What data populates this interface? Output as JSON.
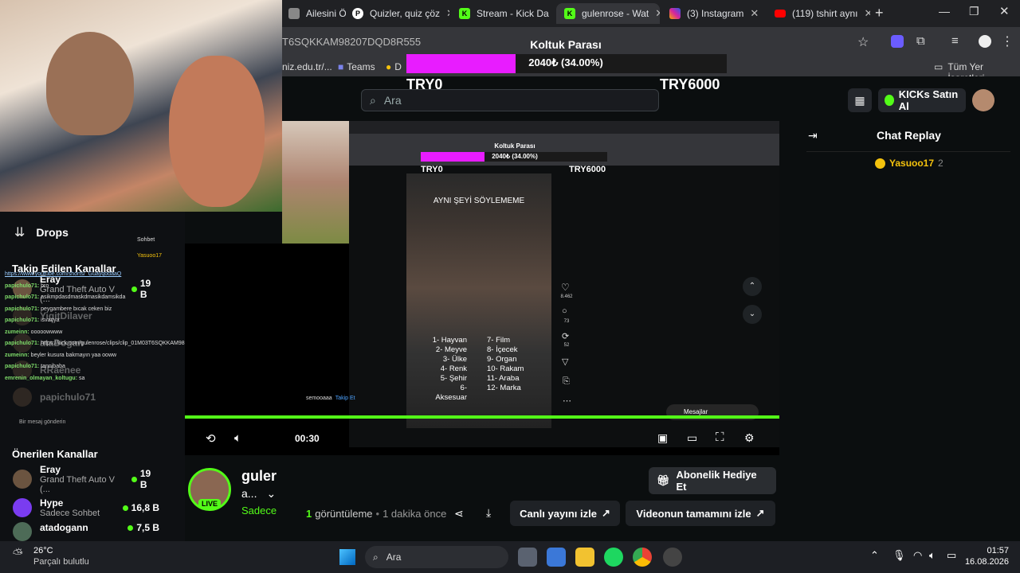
{
  "browser": {
    "tabs": [
      {
        "title": "Ailesini Öld",
        "icon": "generic-icon"
      },
      {
        "title": "Quizler, quiz çöz",
        "icon": "quiz-icon"
      },
      {
        "title": "Stream - Kick Da",
        "icon": "kick-icon"
      },
      {
        "title": "gulenrose - Wat",
        "icon": "kick-icon",
        "active": true
      },
      {
        "title": "(3) Instagram",
        "icon": "instagram-icon"
      },
      {
        "title": "(119) tshirt aynı",
        "icon": "youtube-icon"
      }
    ],
    "url_fragment": "T6SQKKAM98207DQD8R555",
    "bookmarks": [
      "niz.edu.tr/...",
      "Teams",
      "D"
    ],
    "all_bookmarks": "Tüm Yer İşaretleri"
  },
  "overlay": {
    "title": "Koltuk Parası",
    "amount": "2040₺ (34.00%)",
    "progress": 0.34,
    "min": "TRY0",
    "max": "TRY6000"
  },
  "kick": {
    "search_placeholder": "Ara",
    "kicks_button": "KICKs Satın Al",
    "chat_replay_title": "Chat Replay",
    "chat_user": "Yasuoo17",
    "chat_count": "2",
    "drops": "Drops",
    "followed_title": "Takip Edilen Kanallar",
    "followed": [
      {
        "name": "Eray",
        "category": "Grand Theft Auto V (...",
        "viewers": "19 B"
      },
      {
        "name": "YigitDilaver",
        "category": "",
        "viewers": ""
      },
      {
        "name": "ataDogan",
        "category": "",
        "viewers": ""
      },
      {
        "name": "RRaenee",
        "category": "",
        "viewers": ""
      },
      {
        "name": "papichulo71",
        "category": "",
        "viewers": ""
      }
    ],
    "recommended_title": "Önerilen Kanallar",
    "recommended": [
      {
        "name": "Eray",
        "category": "Grand Theft Auto V (...",
        "viewers": "19 B"
      },
      {
        "name": "Hype",
        "category": "Sadece Sohbet",
        "viewers": "16,8 B"
      },
      {
        "name": "atadogann",
        "category": "",
        "viewers": "7,5 B"
      }
    ],
    "streamer_name": "guler",
    "streamer_sub": "a...",
    "live_badge": "LIVE",
    "category_link": "Sadece",
    "views_count": "1",
    "views_label": "görüntüleme",
    "time_ago": "1 dakika önce",
    "gift_button": "Abonelik Hediye Et",
    "watch_live": "Canlı yayını izle",
    "watch_full": "Videonun tamamını izle",
    "player_time": "00:30",
    "player_progress": 1.0
  },
  "inner_stream": {
    "title": "AYNI ŞEYİ SÖYLEMEME",
    "list_left": [
      "1- Hayvan",
      "2- Meyve",
      "3- Ülke",
      "4- Renk",
      "5- Şehir",
      "6- Aksesuar"
    ],
    "list_right": [
      "7- Film",
      "8- İçecek",
      "9- Organ",
      "10- Rakam",
      "11- Araba",
      "12- Marka"
    ],
    "likes": "8.462",
    "comments": "73",
    "shares": "52",
    "messages": "Mesajlar",
    "chat_lines": [
      {
        "user": "papichulo71:",
        "text": "bro"
      },
      {
        "user": "papichulo71:",
        "text": "asikmpdasdmaskdmasikdamsikda"
      },
      {
        "user": "papichulo71:",
        "text": "peygambere bıcak ceken biz"
      },
      {
        "user": "papichulo71:",
        "text": "isvaçya"
      },
      {
        "user": "zumeinn:",
        "text": "ooooowwww"
      },
      {
        "user": "papichulo71:",
        "text": "https://kick.com/gulenrose/clips/clip_01M03T6SQKKAM98207DQD8R555"
      },
      {
        "user": "zumeinn:",
        "text": "beyler kusura bakmayın yaa ooww"
      },
      {
        "user": "papichulo71:",
        "text": "tannibaba"
      },
      {
        "user": "emrenin_olmayan_koltugu:",
        "text": "sa"
      }
    ],
    "yt_link": "https://www.youtube.com/shorts/_GuayqodaaQ",
    "chat_placeholder": "Bir mesaj gönderin",
    "sohbet": "Sohbet",
    "semooaaa": "semooaaa",
    "takip_et": "Takip Et"
  },
  "taskbar": {
    "weather_temp": "26°C",
    "weather_desc": "Parçalı bulutlu",
    "search": "Ara",
    "time": "01:57",
    "date": "16.08.2026"
  },
  "colors": {
    "kick_green": "#53fc18",
    "overlay_magenta": "#e81cff"
  }
}
